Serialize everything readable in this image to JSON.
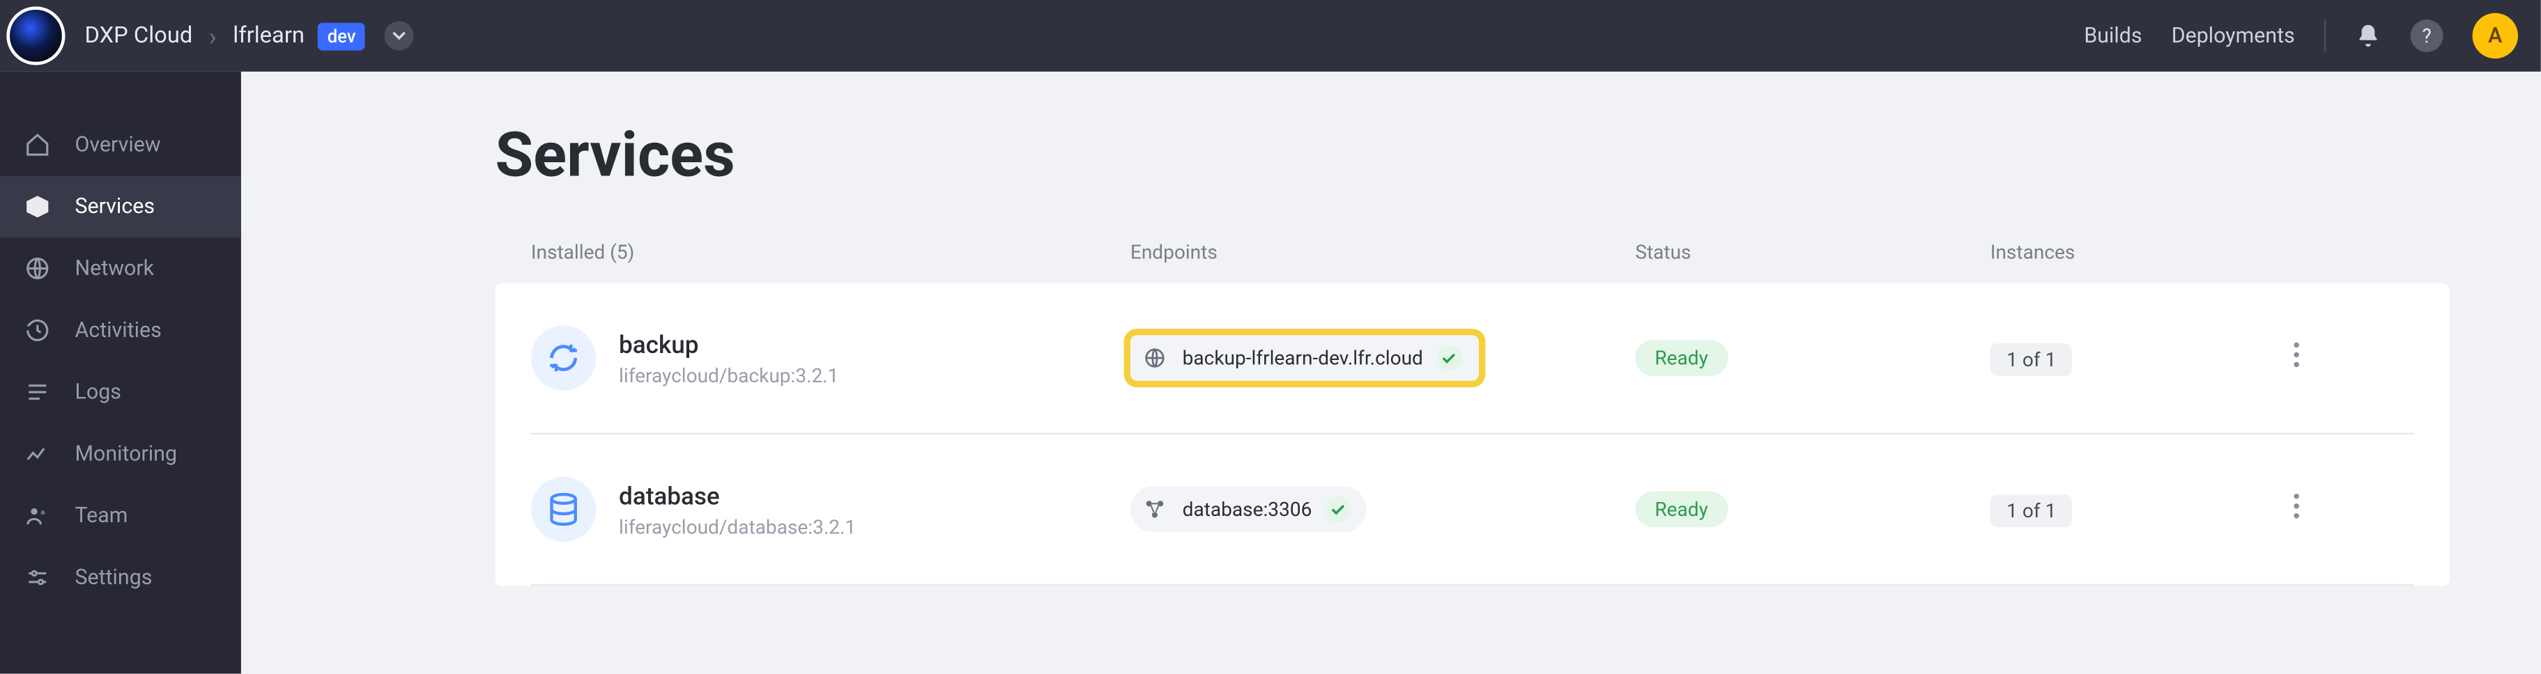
{
  "topbar": {
    "product": "DXP Cloud",
    "project": "lfrlearn",
    "env": "dev",
    "links": {
      "builds": "Builds",
      "deployments": "Deployments"
    },
    "help_symbol": "?",
    "avatar_initial": "A"
  },
  "sidebar": {
    "items": [
      {
        "label": "Overview"
      },
      {
        "label": "Services"
      },
      {
        "label": "Network"
      },
      {
        "label": "Activities"
      },
      {
        "label": "Logs"
      },
      {
        "label": "Monitoring"
      },
      {
        "label": "Team"
      },
      {
        "label": "Settings"
      }
    ]
  },
  "page": {
    "title": "Services",
    "columns": {
      "installed": "Installed (5)",
      "endpoints": "Endpoints",
      "status": "Status",
      "instances": "Instances"
    }
  },
  "services": [
    {
      "name": "backup",
      "image": "liferaycloud/backup:3.2.1",
      "endpoint": "backup-lfrlearn-dev.lfr.cloud",
      "endpoint_kind": "public",
      "status": "Ready",
      "instances": "1 of 1",
      "highlighted": true
    },
    {
      "name": "database",
      "image": "liferaycloud/database:3.2.1",
      "endpoint": "database:3306",
      "endpoint_kind": "internal",
      "status": "Ready",
      "instances": "1 of 1",
      "highlighted": false
    }
  ]
}
